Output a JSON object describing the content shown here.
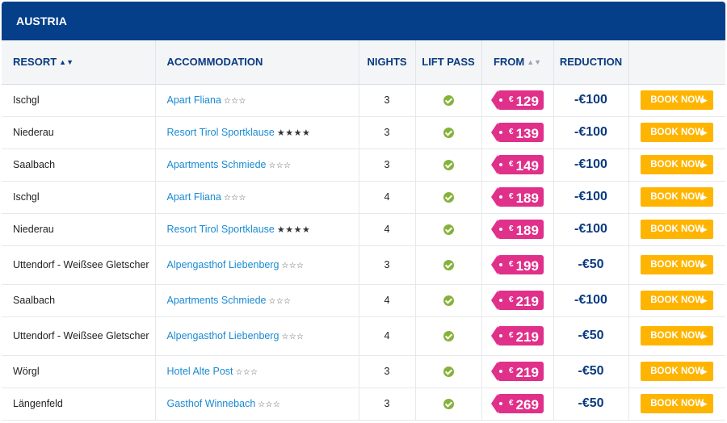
{
  "region": {
    "title": "AUSTRIA"
  },
  "columns": {
    "resort": "RESORT",
    "accommodation": "ACCOMMODATION",
    "nights": "NIGHTS",
    "lift_pass": "LIFT PASS",
    "from": "FROM",
    "reduction": "REDUCTION"
  },
  "currency": "€",
  "book_label": "BOOK NOW",
  "colors": {
    "header_bg": "#053f8a",
    "price_tag": "#e0308a",
    "book_button": "#ffb400",
    "check": "#86b23a",
    "link": "#1a8ad2"
  },
  "rows": [
    {
      "resort": "Ischgl",
      "accommodation": "Apart Fliana",
      "stars": "☆☆☆",
      "nights": "3",
      "lift_pass": true,
      "price": "129",
      "reduction": "-€100"
    },
    {
      "resort": "Niederau",
      "accommodation": "Resort Tirol Sportklause",
      "stars": "★★★★",
      "nights": "3",
      "lift_pass": true,
      "price": "139",
      "reduction": "-€100"
    },
    {
      "resort": "Saalbach",
      "accommodation": "Apartments Schmiede",
      "stars": "☆☆☆",
      "nights": "3",
      "lift_pass": true,
      "price": "149",
      "reduction": "-€100"
    },
    {
      "resort": "Ischgl",
      "accommodation": "Apart Fliana",
      "stars": "☆☆☆",
      "nights": "4",
      "lift_pass": true,
      "price": "189",
      "reduction": "-€100"
    },
    {
      "resort": "Niederau",
      "accommodation": "Resort Tirol Sportklause",
      "stars": "★★★★",
      "nights": "4",
      "lift_pass": true,
      "price": "189",
      "reduction": "-€100"
    },
    {
      "resort": "Uttendorf - Weißsee Gletscher",
      "accommodation": "Alpengasthof Liebenberg",
      "stars": "☆☆☆",
      "nights": "3",
      "lift_pass": true,
      "price": "199",
      "reduction": "-€50"
    },
    {
      "resort": "Saalbach",
      "accommodation": "Apartments Schmiede",
      "stars": "☆☆☆",
      "nights": "4",
      "lift_pass": true,
      "price": "219",
      "reduction": "-€100"
    },
    {
      "resort": "Uttendorf - Weißsee Gletscher",
      "accommodation": "Alpengasthof Liebenberg",
      "stars": "☆☆☆",
      "nights": "4",
      "lift_pass": true,
      "price": "219",
      "reduction": "-€50"
    },
    {
      "resort": "Wörgl",
      "accommodation": "Hotel Alte Post",
      "stars": "☆☆☆",
      "nights": "3",
      "lift_pass": true,
      "price": "219",
      "reduction": "-€50"
    },
    {
      "resort": "Längenfeld",
      "accommodation": "Gasthof Winnebach",
      "stars": "☆☆☆",
      "nights": "3",
      "lift_pass": true,
      "price": "269",
      "reduction": "-€50"
    }
  ]
}
